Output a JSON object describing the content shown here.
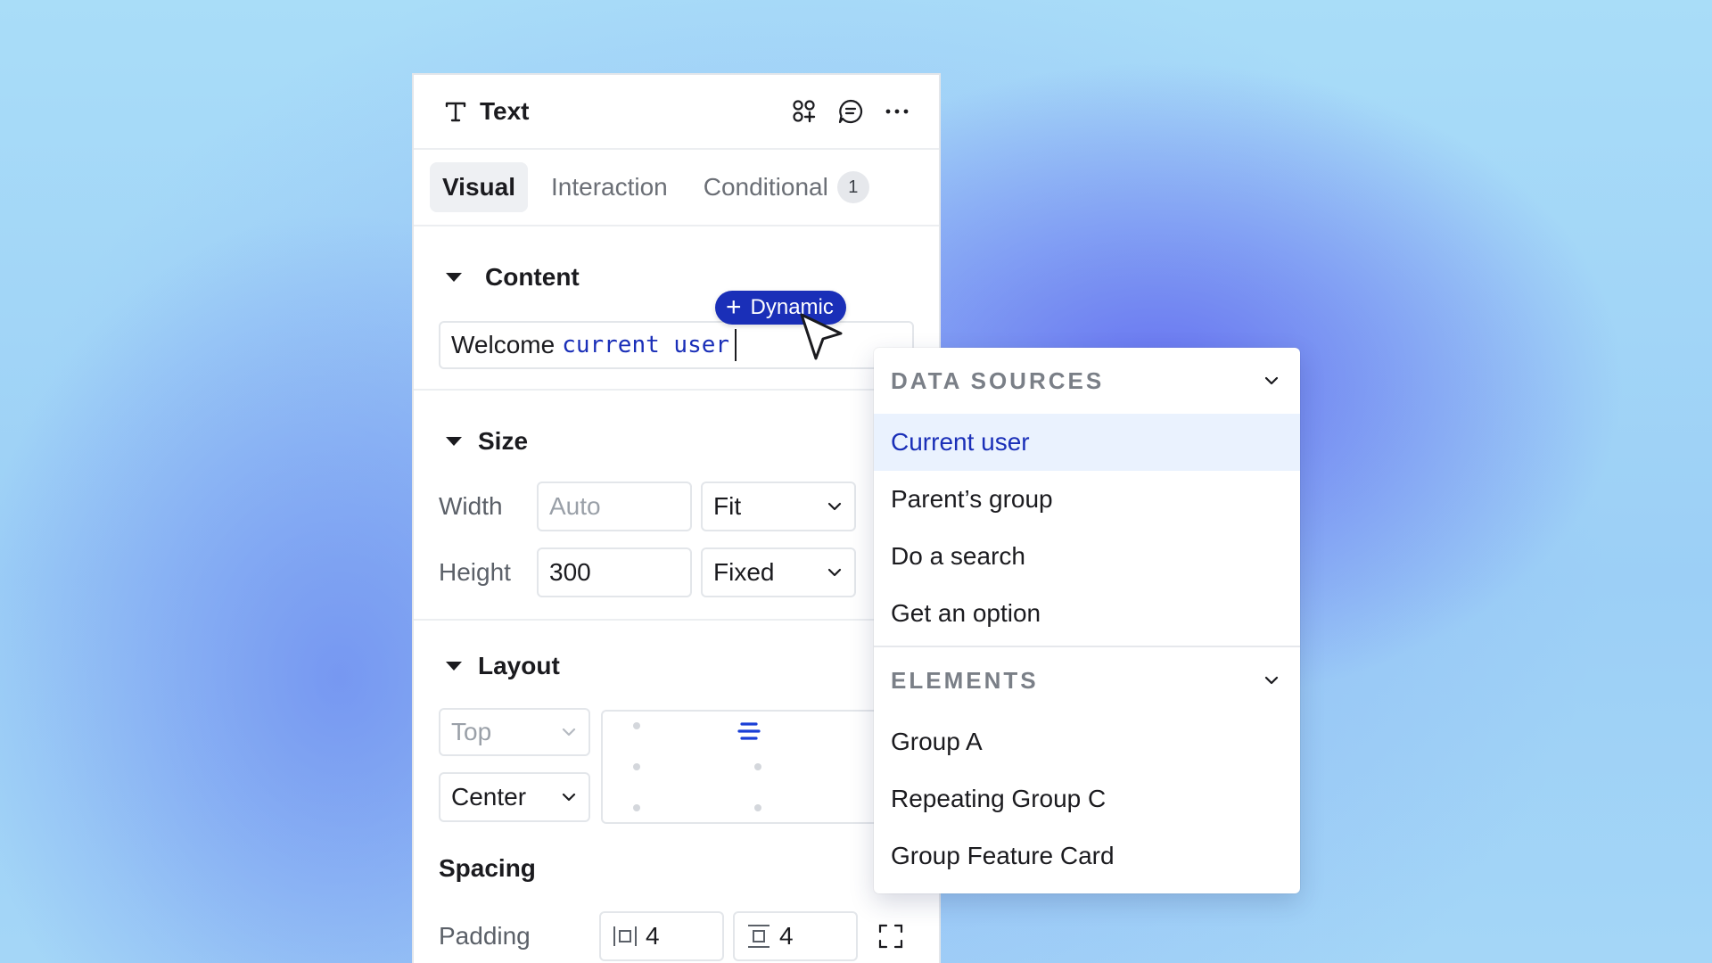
{
  "panel": {
    "title": "Text",
    "title_icon": "text-type-icon",
    "header_actions": [
      "components-icon",
      "comment-icon",
      "more-icon"
    ]
  },
  "tabs": [
    {
      "label": "Visual",
      "active": true
    },
    {
      "label": "Interaction",
      "active": false
    },
    {
      "label": "Conditional",
      "active": false,
      "badge": "1"
    }
  ],
  "content": {
    "title": "Content",
    "static_text": "Welcome",
    "dynamic_text": "current user"
  },
  "dynamic_chip": {
    "label": "Dynamic"
  },
  "size": {
    "title": "Size",
    "width_label": "Width",
    "width_placeholder": "Auto",
    "width_mode": "Fit",
    "height_label": "Height",
    "height_value": "300",
    "height_mode": "Fixed"
  },
  "layout": {
    "title": "Layout",
    "vertical_align": "Top",
    "horizontal_align": "Center"
  },
  "spacing": {
    "title": "Spacing",
    "padding_label": "Padding",
    "padding_horizontal": "4",
    "padding_vertical": "4"
  },
  "dropdown": {
    "data_sources": {
      "label": "DATA SOURCES",
      "items": [
        "Current user",
        "Parent’s group",
        "Do a search",
        "Get an option"
      ],
      "selected": "Current user"
    },
    "elements": {
      "label": "ELEMENTS",
      "items": [
        "Group A",
        "Repeating Group C",
        "Group Feature Card"
      ]
    }
  },
  "colors": {
    "accent": "#1a2fb8",
    "selected_bg": "#eaf2fe"
  }
}
